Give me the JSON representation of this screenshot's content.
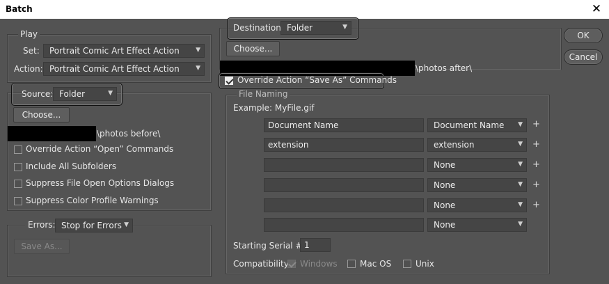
{
  "window": {
    "title": "Batch",
    "close_glyph": "✕"
  },
  "buttons": {
    "ok": "OK",
    "cancel": "Cancel"
  },
  "play": {
    "legend": "Play",
    "set_label": "Set:",
    "set_value": "Portrait Comic Art Effect Action",
    "action_label": "Action:",
    "action_value": "Portrait Comic Art Effect Action"
  },
  "source": {
    "label": "Source:",
    "value": "Folder",
    "choose_label": "Choose...",
    "path": "\\photos before\\",
    "checkboxes": [
      {
        "label": "Override Action “Open” Commands",
        "checked": false
      },
      {
        "label": "Include All Subfolders",
        "checked": false
      },
      {
        "label": "Suppress File Open Options Dialogs",
        "checked": false
      },
      {
        "label": "Suppress Color Profile Warnings",
        "checked": false
      }
    ]
  },
  "errors": {
    "label": "Errors:",
    "value": "Stop for Errors",
    "save_as_label": "Save As..."
  },
  "destination": {
    "label": "Destination:",
    "value": "Folder",
    "choose_label": "Choose...",
    "path": "\\photos after\\",
    "override_label": "Override Action “Save As” Commands",
    "override_checked": true
  },
  "file_naming": {
    "legend": "File Naming",
    "example_label": "Example: MyFile.gif",
    "rows": [
      {
        "text": "Document Name",
        "select": "Document Name",
        "plus": true
      },
      {
        "text": "extension",
        "select": "extension",
        "plus": true
      },
      {
        "text": "",
        "select": "None",
        "plus": true
      },
      {
        "text": "",
        "select": "None",
        "plus": true
      },
      {
        "text": "",
        "select": "None",
        "plus": true
      },
      {
        "text": "",
        "select": "None",
        "plus": false
      }
    ],
    "serial_label": "Starting Serial #:",
    "serial_value": "1",
    "compat_label": "Compatibility:",
    "compat": [
      {
        "label": "Windows",
        "checked": true,
        "disabled": true
      },
      {
        "label": "Mac OS",
        "checked": false,
        "disabled": false
      },
      {
        "label": "Unix",
        "checked": false,
        "disabled": false
      }
    ]
  },
  "icons": {
    "chevron": "chevron-down-icon",
    "plus": "plus-icon",
    "check": "checkmark-icon"
  },
  "colors": {
    "dialog_bg": "#535353",
    "field_bg": "#454545",
    "title_bg": "#ffffff",
    "redaction": "#000000"
  }
}
